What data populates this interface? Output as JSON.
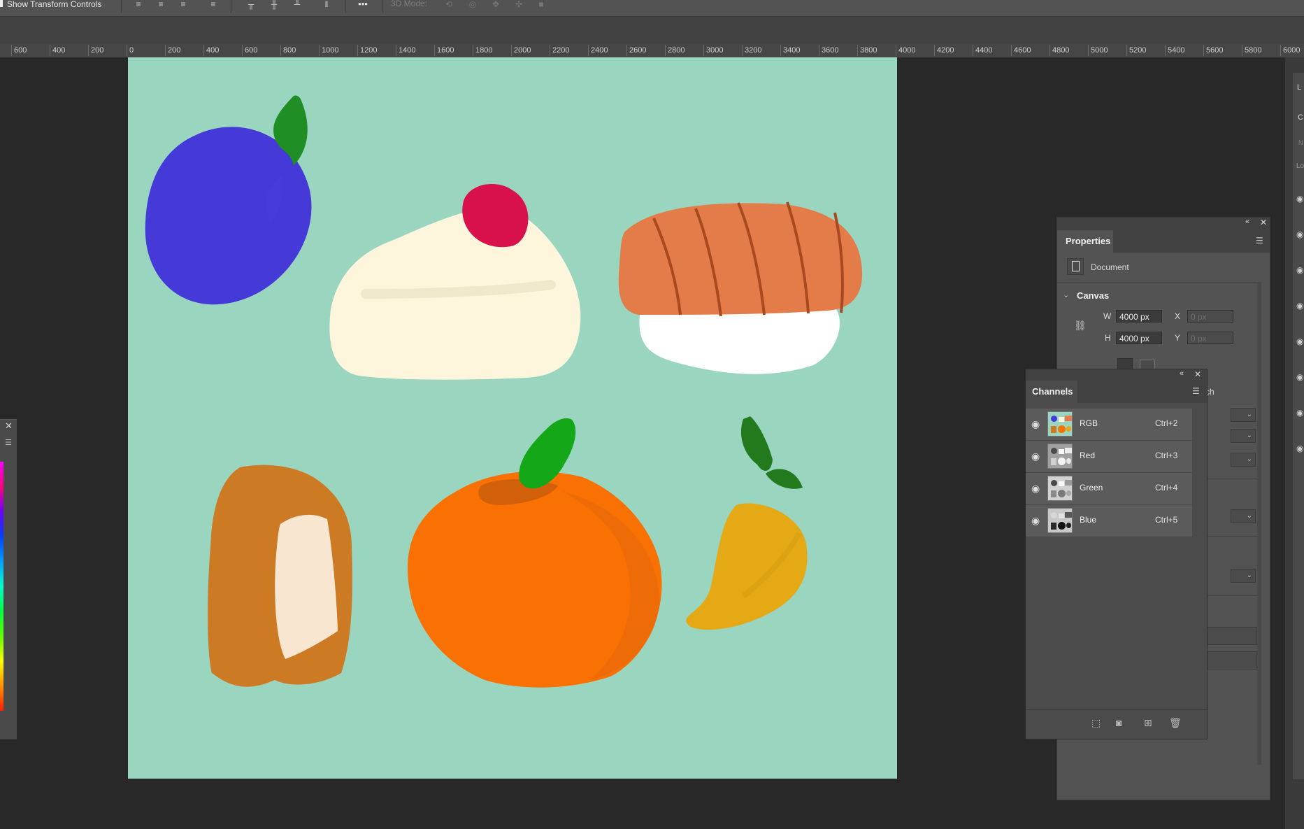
{
  "option_bar": {
    "show_transform_controls": "Show Transform Controls",
    "more": "•••",
    "mode_3d": "3D Mode:",
    "align_icons": [
      "align-left-icon",
      "align-hcenter-icon",
      "align-right-icon",
      "distribute-icon",
      "align-top-icon",
      "align-vcenter-icon",
      "align-bottom-icon",
      "distribute-v-icon"
    ]
  },
  "ruler": {
    "ticks": [
      "600",
      "400",
      "200",
      "0",
      "200",
      "400",
      "600",
      "800",
      "1000",
      "1200",
      "1400",
      "1600",
      "1800",
      "2000",
      "2200",
      "2400",
      "2600",
      "2800",
      "3000",
      "3200",
      "3400",
      "3600",
      "3800",
      "4000",
      "4200",
      "4400",
      "4600",
      "4800",
      "5000",
      "5200",
      "5400",
      "5600",
      "5800",
      "6000"
    ]
  },
  "canvas": {
    "background": "#9ad5c0",
    "objects": [
      "blueberry",
      "strawberry-cake",
      "salmon-sushi",
      "bread",
      "orange",
      "mango"
    ]
  },
  "properties": {
    "tab": "Properties",
    "document_label": "Document",
    "canvas_section": "Canvas",
    "w_label": "W",
    "w_value": "4000 px",
    "h_label": "H",
    "h_value": "4000 px",
    "x_label": "X",
    "x_value": "0 px",
    "y_label": "Y",
    "y_value": "0 px",
    "partial_label": "ch"
  },
  "channels": {
    "tab": "Channels",
    "rows": [
      {
        "name": "RGB",
        "shortcut": "Ctrl+2"
      },
      {
        "name": "Red",
        "shortcut": "Ctrl+3"
      },
      {
        "name": "Green",
        "shortcut": "Ctrl+4"
      },
      {
        "name": "Blue",
        "shortcut": "Ctrl+5"
      }
    ]
  },
  "right_edge": {
    "partial_texts": [
      "L",
      "C",
      "N",
      "Lo"
    ]
  }
}
